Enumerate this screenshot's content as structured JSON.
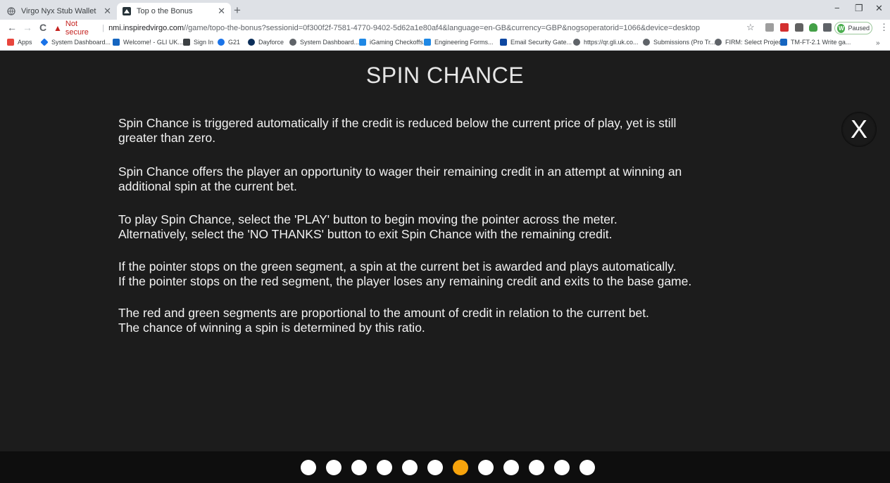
{
  "browser": {
    "tabs": [
      {
        "title": "Virgo Nyx Stub Wallet",
        "active": false
      },
      {
        "title": "Top o the Bonus",
        "active": true
      }
    ],
    "new_tab_label": "+",
    "window_controls": {
      "minimize": "−",
      "restore": "❐",
      "close": "✕"
    },
    "nav": {
      "back": "←",
      "forward": "→",
      "reload": "C"
    },
    "address_bar": {
      "security_label": "Not secure",
      "host": "nmi.inspiredvirgo.com",
      "path": "//game/topo-the-bonus?sessionid=0f300f2f-7581-4770-9402-5d62a1e80af4&language=en-GB&currency=GBP&nogsoperatorid=1066&device=desktop"
    },
    "star_icon": "☆",
    "profile": {
      "initial": "W",
      "status": "Paused"
    },
    "menu_icon": "⋮",
    "bookmarks": [
      {
        "label": "Apps",
        "color": "#e8453c"
      },
      {
        "label": "System Dashboard...",
        "color": "#1a73e8"
      },
      {
        "label": "Welcome! - GLI UK...",
        "color": "#1565c0"
      },
      {
        "label": "Sign In",
        "color": "#3c4043"
      },
      {
        "label": "G21",
        "color": "#1a73e8"
      },
      {
        "label": "Dayforce",
        "color": "#0b2e59"
      },
      {
        "label": "System Dashboard...",
        "color": "#5f6368"
      },
      {
        "label": "iGaming Checkoffs...",
        "color": "#1e88e5"
      },
      {
        "label": "Engineering Forms...",
        "color": "#1e88e5"
      },
      {
        "label": "Email Security Gate...",
        "color": "#0d47a1"
      },
      {
        "label": "https://qr.gli.uk.co...",
        "color": "#5f6368"
      },
      {
        "label": "Submissions (Pro Tr...",
        "color": "#5f6368"
      },
      {
        "label": "FIRM: Select Project",
        "color": "#5f6368"
      },
      {
        "label": "TM-FT-2.1 Write ga...",
        "color": "#1565c0"
      }
    ],
    "bookmarks_more": "»"
  },
  "help": {
    "title": "SPIN CHANCE",
    "close_label": "X",
    "paragraphs": [
      [
        "Spin Chance is triggered automatically if the credit is reduced below the current price of play, yet is still",
        "greater than zero."
      ],
      [
        "Spin Chance offers the player an opportunity to wager their remaining credit in an attempt at winning an",
        "additional spin at the current bet."
      ],
      [
        "To play Spin Chance, select the 'PLAY' button to begin moving the pointer across the meter.",
        "Alternatively, select the 'NO THANKS' button to exit Spin Chance with the remaining credit."
      ],
      [
        "If the pointer stops on the green segment, a spin at the current bet is awarded and plays automatically.",
        "If the pointer stops on the red segment, the player loses any remaining credit and exits to the base game."
      ],
      [
        "The red and green segments are proportional to the amount of credit in relation to the current bet.",
        "The chance of winning a spin is determined by this ratio."
      ]
    ],
    "page_count": 12,
    "current_page": 7,
    "colors": {
      "active_dot": "#f7a30c",
      "inactive_dot": "#ffffff",
      "background": "#1c1c1c"
    }
  }
}
